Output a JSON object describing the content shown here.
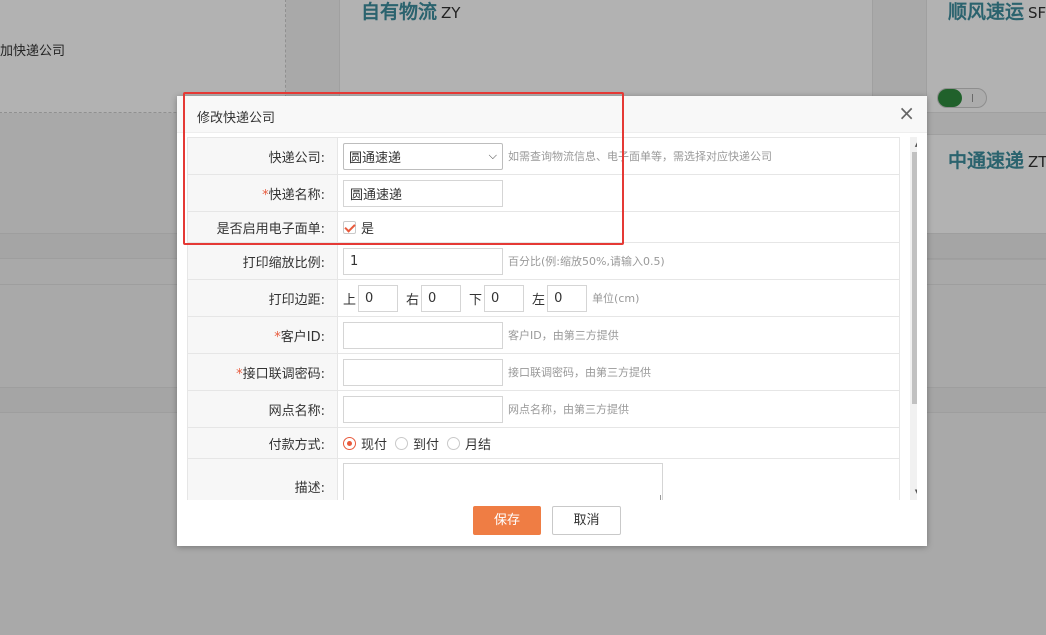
{
  "background": {
    "add_company_link": "加快递公司",
    "cards": [
      {
        "name": "自有物流",
        "code": "ZY"
      },
      {
        "name": "顺风速运",
        "code": "SF"
      },
      {
        "name": "中通速递",
        "code": "ZT"
      }
    ]
  },
  "dialog": {
    "title": "修改快递公司",
    "close_symbol": "×",
    "fields": {
      "company": {
        "label": "快递公司:",
        "selected": "圆通速递",
        "hint": "如需查询物流信息、电子面单等，需选择对应快递公司"
      },
      "express_name": {
        "required_mark": "*",
        "label": "快递名称:",
        "value": "圆通速递"
      },
      "enable_e_waybill": {
        "label": "是否启用电子面单:",
        "option": "是",
        "checked": true
      },
      "print_scale": {
        "label": "打印缩放比例:",
        "value": "1",
        "hint": "百分比(例:缩放50%,请输入0.5)"
      },
      "print_margin": {
        "label": "打印边距:",
        "top_label": "上",
        "top_value": "0",
        "right_label": "右",
        "right_value": "0",
        "bottom_label": "下",
        "bottom_value": "0",
        "left_label": "左",
        "left_value": "0",
        "unit_hint": "单位(cm)"
      },
      "customer_id": {
        "required_mark": "*",
        "label": "客户ID:",
        "value": "",
        "hint": "客户ID，由第三方提供"
      },
      "api_key": {
        "required_mark": "*",
        "label": "接口联调密码:",
        "value": "",
        "hint": "接口联调密码，由第三方提供"
      },
      "branch_name": {
        "label": "网点名称:",
        "value": "",
        "hint": "网点名称，由第三方提供"
      },
      "payment": {
        "label": "付款方式:",
        "options": [
          "现付",
          "到付",
          "月结"
        ],
        "selected": "现付"
      },
      "description": {
        "label": "描述:",
        "value": ""
      }
    },
    "buttons": {
      "save": "保存",
      "cancel": "取消"
    }
  },
  "colors": {
    "accent": "#ef7d44",
    "required": "#e85a3c",
    "highlight": "#e53935",
    "card_title": "#3e8e9e"
  }
}
